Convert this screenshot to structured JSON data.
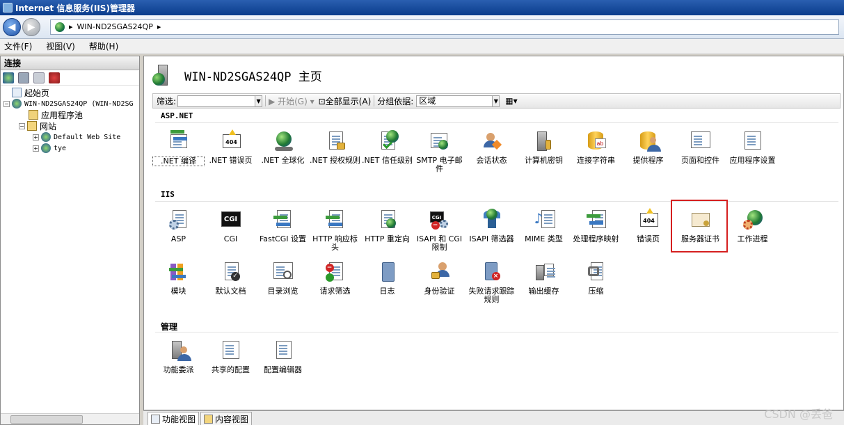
{
  "window": {
    "title": "Internet 信息服务(IIS)管理器"
  },
  "address": {
    "path": "WIN-ND2SGAS24QP",
    "arrow": "▸"
  },
  "menu": [
    "文件(F)",
    "视图(V)",
    "帮助(H)"
  ],
  "connections": {
    "header": "连接",
    "tree": [
      {
        "label": "起始页"
      },
      {
        "label": "WIN-ND2SGAS24QP (WIN-ND2SG"
      },
      {
        "label": "应用程序池"
      },
      {
        "label": "网站"
      },
      {
        "label": "Default Web Site"
      },
      {
        "label": "tye"
      }
    ]
  },
  "home": {
    "title": "WIN-ND2SGAS24QP 主页"
  },
  "filter": {
    "label": "筛选:",
    "start": "开始(G)",
    "show_all": "全部显示(A)",
    "group_by": "分组依据:",
    "group_value": "区域"
  },
  "sections": {
    "aspnet": "ASP.NET",
    "iis": "IIS",
    "manage": "管理"
  },
  "features": {
    "aspnet": [
      ".NET 编译",
      ".NET 错误页",
      ".NET 全球化",
      ".NET 授权规则",
      ".NET 信任级别",
      "SMTP 电子邮件",
      "会话状态",
      "计算机密钥",
      "连接字符串",
      "提供程序",
      "页面和控件",
      "应用程序设置"
    ],
    "iis_row1": [
      "ASP",
      "CGI",
      "FastCGI 设置",
      "HTTP 响应标头",
      "HTTP 重定向",
      "ISAPI 和 CGI 限制",
      "ISAPI 筛选器",
      "MIME 类型",
      "处理程序映射",
      "错误页",
      "服务器证书",
      "工作进程"
    ],
    "iis_row2": [
      "模块",
      "默认文档",
      "目录浏览",
      "请求筛选",
      "日志",
      "身份验证",
      "失败请求跟踪规则",
      "输出缓存",
      "压缩"
    ],
    "manage": [
      "功能委派",
      "共享的配置",
      "配置编辑器"
    ]
  },
  "icons": {
    "cgi_text": "CGI",
    "error_text": "404"
  },
  "bottom_tabs": {
    "features": "功能视图",
    "content": "内容视图"
  },
  "watermark": "CSDN @丢爸"
}
